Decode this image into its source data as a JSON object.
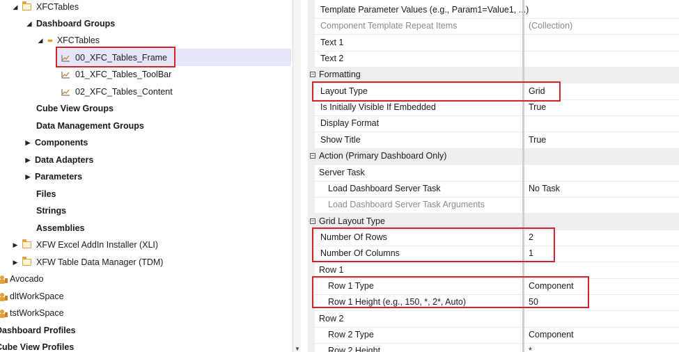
{
  "tree": {
    "items": [
      {
        "label": "XFCTables",
        "bold": false
      },
      {
        "label": "Dashboard Groups",
        "bold": true
      },
      {
        "label": "XFCTables",
        "bold": false
      },
      {
        "label": "00_XFC_Tables_Frame",
        "bold": false
      },
      {
        "label": "01_XFC_Tables_ToolBar",
        "bold": false
      },
      {
        "label": "02_XFC_Tables_Content",
        "bold": false
      },
      {
        "label": "Cube View Groups",
        "bold": true
      },
      {
        "label": "Data Management Groups",
        "bold": true
      },
      {
        "label": "Components",
        "bold": true
      },
      {
        "label": "Data Adapters",
        "bold": true
      },
      {
        "label": "Parameters",
        "bold": true
      },
      {
        "label": "Files",
        "bold": true
      },
      {
        "label": "Strings",
        "bold": true
      },
      {
        "label": "Assemblies",
        "bold": true
      },
      {
        "label": "XFW Excel AddIn Installer (XLI)",
        "bold": false
      },
      {
        "label": "XFW Table Data Manager (TDM)",
        "bold": false
      },
      {
        "label": "Avocado",
        "bold": false
      },
      {
        "label": "dltWorkSpace",
        "bold": false
      },
      {
        "label": "tstWorkSpace",
        "bold": false
      },
      {
        "label": "Dashboard Profiles",
        "bold": true
      },
      {
        "label": "Cube View Profiles",
        "bold": true
      }
    ],
    "selected_index": 3
  },
  "properties": [
    {
      "name": "Template Parameter Values (e.g., Param1=Value1, ...)",
      "value": "",
      "kind": "prop"
    },
    {
      "name": "Component Template Repeat Items",
      "value": "(Collection)",
      "kind": "grey"
    },
    {
      "name": "Text 1",
      "value": "",
      "kind": "prop"
    },
    {
      "name": "Text 2",
      "value": "",
      "kind": "prop"
    },
    {
      "name": "Formatting",
      "value": "",
      "kind": "cat"
    },
    {
      "name": "Layout Type",
      "value": "Grid",
      "kind": "prop"
    },
    {
      "name": "Is Initially Visible If Embedded",
      "value": "True",
      "kind": "prop"
    },
    {
      "name": "Display Format",
      "value": "",
      "kind": "prop"
    },
    {
      "name": "Show Title",
      "value": "True",
      "kind": "prop"
    },
    {
      "name": "Action (Primary Dashboard Only)",
      "value": "",
      "kind": "cat"
    },
    {
      "name": "Server Task",
      "value": "",
      "kind": "sub"
    },
    {
      "name": "Load Dashboard Server Task",
      "value": "No Task",
      "kind": "prop2"
    },
    {
      "name": "Load Dashboard Server Task Arguments",
      "value": "",
      "kind": "grey2"
    },
    {
      "name": "Grid Layout Type",
      "value": "",
      "kind": "cat"
    },
    {
      "name": "Number Of Rows",
      "value": "2",
      "kind": "prop"
    },
    {
      "name": "Number Of Columns",
      "value": "1",
      "kind": "prop"
    },
    {
      "name": "Row 1",
      "value": "",
      "kind": "sub"
    },
    {
      "name": "Row 1 Type",
      "value": "Component",
      "kind": "prop2"
    },
    {
      "name": "Row 1 Height (e.g., 150, *, 2*, Auto)",
      "value": "50",
      "kind": "prop2"
    },
    {
      "name": "Row 2",
      "value": "",
      "kind": "sub"
    },
    {
      "name": "Row 2 Type",
      "value": "Component",
      "kind": "prop2"
    },
    {
      "name": "Row 2 Height",
      "value": "*",
      "kind": "prop2"
    }
  ],
  "colors": {
    "highlight": "#d2232a",
    "folder": "#e1a13a",
    "selection": "#e6e6fa"
  }
}
